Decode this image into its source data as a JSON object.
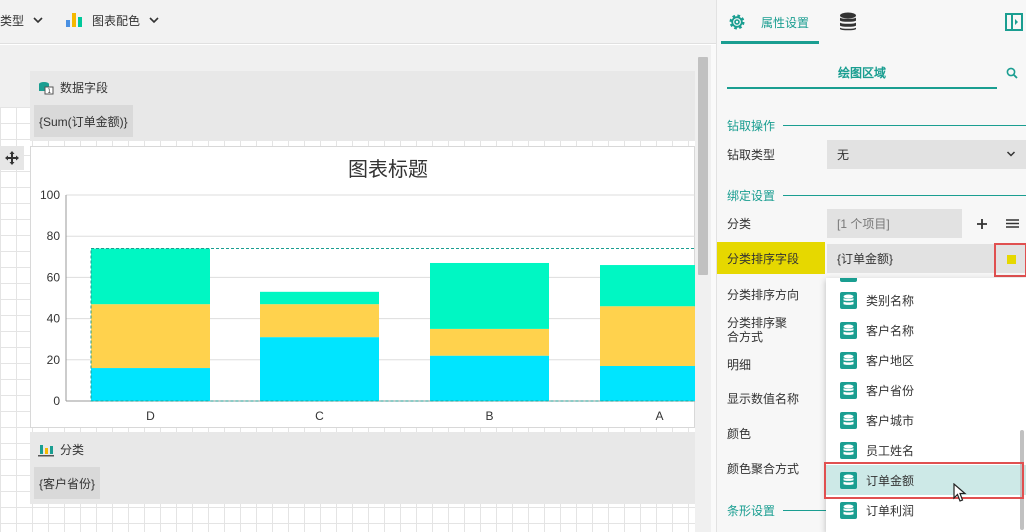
{
  "toolbar": {
    "type_label": "类型",
    "palette_label": "图表配色"
  },
  "colors": {
    "accent": "#1a9e91",
    "highlight_yellow": "#e6d800",
    "series_cyan": "#00e5ff",
    "series_orange": "#ffd24d",
    "series_green": "#00f7c3",
    "red_outline": "#e05050"
  },
  "design": {
    "data_field_zone": {
      "title": "数据字段",
      "tag": "{Sum(订单金额)}"
    },
    "category_zone": {
      "title": "分类",
      "tag": "{客户省份}"
    }
  },
  "chart_data": {
    "type": "bar",
    "stacked": true,
    "title": "图表标题",
    "categories": [
      "D",
      "C",
      "B",
      "A"
    ],
    "series": [
      {
        "color": "#00e5ff",
        "values": [
          16,
          31,
          22,
          17
        ]
      },
      {
        "color": "#ffd24d",
        "values": [
          31,
          16,
          13,
          29
        ]
      },
      {
        "color": "#00f7c3",
        "values": [
          27,
          6,
          32,
          20
        ]
      }
    ],
    "ylim": [
      0,
      100
    ],
    "yticks": [
      "0",
      "20",
      "40",
      "60",
      "80",
      "100"
    ],
    "grid": true,
    "legend": "none"
  },
  "panel": {
    "tab_properties": "属性设置",
    "tab_data_icon": "database-icon",
    "subtab": "绘图区域",
    "drill_section": "钻取操作",
    "drill_type_label": "钻取类型",
    "drill_type_value": "无",
    "binding_section": "绑定设置",
    "category_label": "分类",
    "category_value": "[1 个项目]",
    "sort_field_label": "分类排序字段",
    "sort_field_value": "{订单金额}",
    "sort_direction_label": "分类排序方向",
    "sort_aggregate_label": "分类排序聚合方式",
    "detail_label": "明细",
    "show_value_name_label": "显示数值名称",
    "color_label": "颜色",
    "color_aggregate_label": "颜色聚合方式",
    "bar_section": "条形设置"
  },
  "dropdown": {
    "items": [
      "类别名称",
      "客户名称",
      "客户地区",
      "客户省份",
      "客户城市",
      "员工姓名",
      "订单金额",
      "订单利润"
    ],
    "selected": "订单金额"
  }
}
